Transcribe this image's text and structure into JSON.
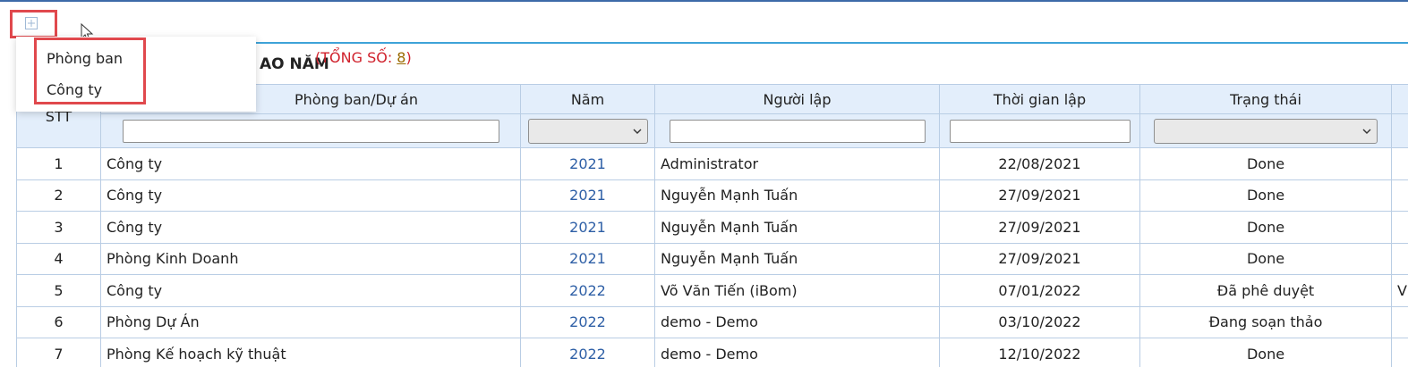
{
  "menu": {
    "items": [
      "Phòng ban",
      "Công ty"
    ]
  },
  "title": {
    "text": "AO NĂM",
    "count_prefix": "(TỔNG SỐ: ",
    "count": "8",
    "count_suffix": ")"
  },
  "table": {
    "headers": {
      "stt": "STT",
      "unit": "Phòng ban/Dự án",
      "year": "Năm",
      "creator": "Người lập",
      "created": "Thời gian lập",
      "status": "Trạng thái"
    },
    "rows": [
      {
        "stt": "1",
        "unit": "Công ty",
        "year": "2021",
        "creator": "Administrator",
        "created": "22/08/2021",
        "status": "Done",
        "extra": ""
      },
      {
        "stt": "2",
        "unit": "Công ty",
        "year": "2021",
        "creator": "Nguyễn Mạnh Tuấn",
        "created": "27/09/2021",
        "status": "Done",
        "extra": ""
      },
      {
        "stt": "3",
        "unit": "Công ty",
        "year": "2021",
        "creator": "Nguyễn Mạnh Tuấn",
        "created": "27/09/2021",
        "status": "Done",
        "extra": ""
      },
      {
        "stt": "4",
        "unit": "Phòng Kinh Doanh",
        "year": "2021",
        "creator": "Nguyễn Mạnh Tuấn",
        "created": "27/09/2021",
        "status": "Done",
        "extra": ""
      },
      {
        "stt": "5",
        "unit": "Công ty",
        "year": "2022",
        "creator": "Võ Văn Tiến (iBom)",
        "created": "07/01/2022",
        "status": "Đã phê duyệt",
        "extra": "V"
      },
      {
        "stt": "6",
        "unit": "Phòng Dự Án",
        "year": "2022",
        "creator": "demo - Demo",
        "created": "03/10/2022",
        "status": "Đang soạn thảo",
        "extra": ""
      },
      {
        "stt": "7",
        "unit": "Phòng Kế hoạch kỹ thuật",
        "year": "2022",
        "creator": "demo - Demo",
        "created": "12/10/2022",
        "status": "Done",
        "extra": ""
      }
    ]
  },
  "colors": {
    "accent": "#3ea3d8",
    "highlight": "#e0484d",
    "header_bg": "#e3eefb",
    "link": "#2e5fa6",
    "count": "#d0202b"
  }
}
